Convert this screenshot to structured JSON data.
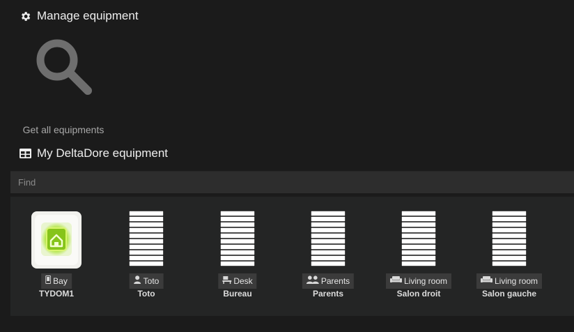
{
  "manage": {
    "title": "Manage equipment",
    "icon": "gear-icon"
  },
  "get_all": {
    "caption": "Get all equipments",
    "icon": "magnifier-icon"
  },
  "my_equipment": {
    "title": "My DeltaDore equipment",
    "icon": "table-grid-icon"
  },
  "search": {
    "placeholder": "Find"
  },
  "colors": {
    "background": "#1b1b1b",
    "panel": "#242525",
    "tag": "#3b3b3b",
    "box_green": "#8fd21f"
  },
  "equipments": [
    {
      "tag": "Bay",
      "name": "TYDOM1",
      "tag_icon": "phone-icon",
      "image": "tydom-box"
    },
    {
      "tag": "Toto",
      "name": "Toto",
      "tag_icon": "user-icon",
      "image": "roller-shutter"
    },
    {
      "tag": "Desk",
      "name": "Bureau",
      "tag_icon": "desk-icon",
      "image": "roller-shutter"
    },
    {
      "tag": "Parents",
      "name": "Parents",
      "tag_icon": "users-icon",
      "image": "roller-shutter"
    },
    {
      "tag": "Living room",
      "name": "Salon droit",
      "tag_icon": "sofa-icon",
      "image": "roller-shutter"
    },
    {
      "tag": "Living room",
      "name": "Salon gauche",
      "tag_icon": "sofa-icon",
      "image": "roller-shutter"
    }
  ]
}
